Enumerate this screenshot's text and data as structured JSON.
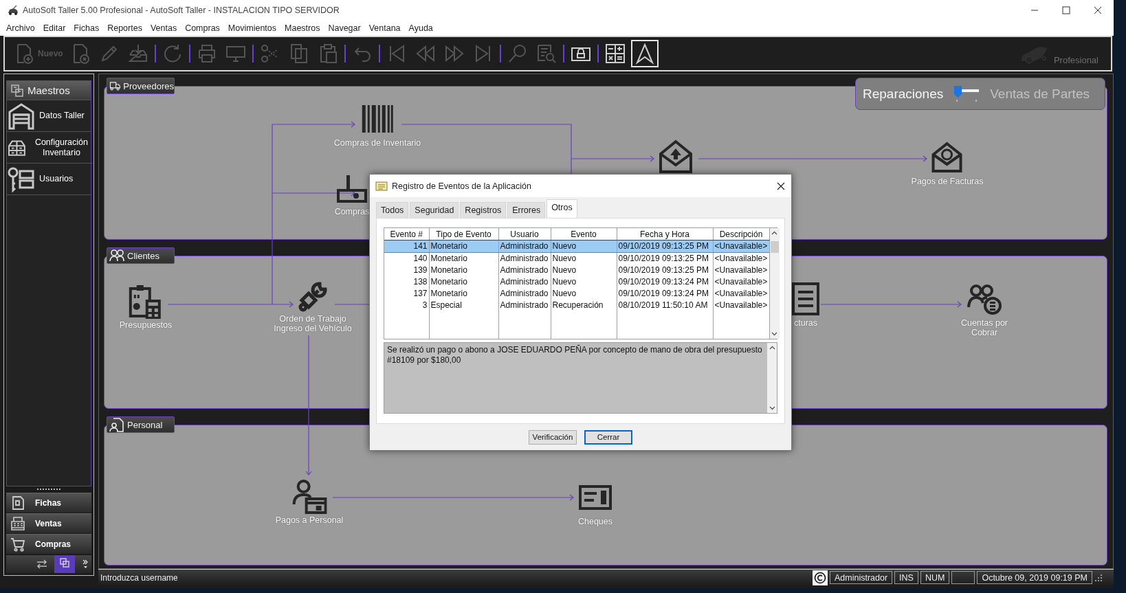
{
  "window": {
    "title": "AutoSoft Taller 5.00 Profesional - AutoSoft Taller - INSTALACION TIPO SERVIDOR"
  },
  "menu": [
    "Archivo",
    "Editar",
    "Fichas",
    "Reportes",
    "Ventas",
    "Compras",
    "Movimientos",
    "Maestros",
    "Navegar",
    "Ventana",
    "Ayuda"
  ],
  "toolbar": {
    "items": [
      {
        "kind": "button",
        "label": "Nuevo",
        "disabled": true,
        "pressed": false
      },
      {
        "kind": "button",
        "disabled": true,
        "pressed": false
      },
      {
        "kind": "button",
        "disabled": true,
        "pressed": false
      },
      {
        "kind": "button",
        "disabled": true,
        "pressed": false
      },
      {
        "kind": "separator"
      },
      {
        "kind": "button",
        "disabled": true,
        "pressed": false
      },
      {
        "kind": "separator"
      },
      {
        "kind": "button",
        "disabled": true,
        "pressed": false
      },
      {
        "kind": "button",
        "disabled": true,
        "pressed": false
      },
      {
        "kind": "separator"
      },
      {
        "kind": "button",
        "disabled": true,
        "pressed": false
      },
      {
        "kind": "button",
        "disabled": true,
        "pressed": false
      },
      {
        "kind": "button",
        "disabled": true,
        "pressed": false
      },
      {
        "kind": "separator"
      },
      {
        "kind": "button",
        "disabled": true,
        "pressed": false
      },
      {
        "kind": "separator"
      },
      {
        "kind": "button",
        "disabled": true,
        "pressed": false
      },
      {
        "kind": "button",
        "disabled": true,
        "pressed": false
      },
      {
        "kind": "button",
        "disabled": true,
        "pressed": false
      },
      {
        "kind": "button",
        "disabled": true,
        "pressed": false
      },
      {
        "kind": "separator"
      },
      {
        "kind": "button",
        "disabled": true,
        "pressed": false
      },
      {
        "kind": "button",
        "disabled": true,
        "pressed": false
      },
      {
        "kind": "separator"
      },
      {
        "kind": "button",
        "disabled": false,
        "pressed": false
      },
      {
        "kind": "separator"
      },
      {
        "kind": "button",
        "disabled": false,
        "pressed": false
      },
      {
        "kind": "button",
        "disabled": false,
        "pressed": true
      }
    ]
  },
  "brand": {
    "edition": "Profesional"
  },
  "sidebar": {
    "groups": [
      {
        "label": "Maestros",
        "expanded": true,
        "items": [
          "Datos Taller",
          "Configuración Inventario",
          "Usuarios"
        ]
      },
      {
        "label": "Fichas",
        "expanded": false
      },
      {
        "label": "Ventas",
        "expanded": false
      },
      {
        "label": "Compras",
        "expanded": false
      }
    ]
  },
  "mode_switch": {
    "options": [
      {
        "label": "Reparaciones",
        "selected": true
      },
      {
        "label": "Ventas de Partes",
        "selected": false
      }
    ]
  },
  "sections": [
    {
      "title": "Proveedores"
    },
    {
      "title": "Clientes"
    },
    {
      "title": "Personal"
    }
  ],
  "flow_nodes": [
    {
      "label": "Compras de Inventario"
    },
    {
      "label": "Compras"
    },
    {
      "label": "Pagos de Facturas"
    },
    {
      "label": "Presupuestos"
    },
    {
      "label": "Orden de Trabajo Ingreso del Vehículo"
    },
    {
      "label": "cturas"
    },
    {
      "label": "Cuentas por Cobrar"
    },
    {
      "label": "Pagos a Personal"
    },
    {
      "label": "Cheques"
    }
  ],
  "dialog": {
    "title": "Registro de Eventos de la Aplicación",
    "tabs": [
      {
        "label": "Todos",
        "selected": false
      },
      {
        "label": "Seguridad",
        "selected": false
      },
      {
        "label": "Registros",
        "selected": false
      },
      {
        "label": "Errores",
        "selected": false
      },
      {
        "label": "Otros",
        "selected": true
      }
    ],
    "table": {
      "columns": [
        "Evento #",
        "Tipo de Evento",
        "Usuario",
        "Evento",
        "Fecha y Hora",
        "Descripción"
      ],
      "rows": [
        {
          "cells": [
            "141",
            "Monetario",
            "Administrado",
            "Nuevo",
            "09/10/2019 09:13:25 PM",
            "<Unavailable>"
          ],
          "selected": true
        },
        {
          "cells": [
            "140",
            "Monetario",
            "Administrado",
            "Nuevo",
            "09/10/2019 09:13:25 PM",
            "<Unavailable>"
          ],
          "selected": false
        },
        {
          "cells": [
            "139",
            "Monetario",
            "Administrado",
            "Nuevo",
            "09/10/2019 09:13:25 PM",
            "<Unavailable>"
          ],
          "selected": false
        },
        {
          "cells": [
            "138",
            "Monetario",
            "Administrado",
            "Nuevo",
            "09/10/2019 09:13:24 PM",
            "<Unavailable>"
          ],
          "selected": false
        },
        {
          "cells": [
            "137",
            "Monetario",
            "Administrado",
            "Nuevo",
            "09/10/2019 09:13:24 PM",
            "<Unavailable>"
          ],
          "selected": false
        },
        {
          "cells": [
            "3",
            "Especial",
            "Administrado",
            "Recuperación",
            "08/10/2019 11:50:10 AM",
            "<Unavailable>"
          ],
          "selected": false
        }
      ]
    },
    "description": "Se realizó un pago o abono a JOSE EDUARDO PEÑA por concepto de mano de obra del presupuesto #18109 por $180,00",
    "buttons": [
      {
        "label": "Verificación",
        "default": false
      },
      {
        "label": "Cerrar",
        "default": true
      }
    ]
  },
  "status_bar": {
    "message": "Introduzca username",
    "panels": [
      {
        "kind": "icon"
      },
      {
        "kind": "text",
        "text": "Administrador"
      },
      {
        "kind": "text",
        "text": "INS"
      },
      {
        "kind": "text",
        "text": "NUM"
      },
      {
        "kind": "blank"
      },
      {
        "kind": "text",
        "text": "Octubre 09, 2019 09:19 PM"
      }
    ]
  }
}
